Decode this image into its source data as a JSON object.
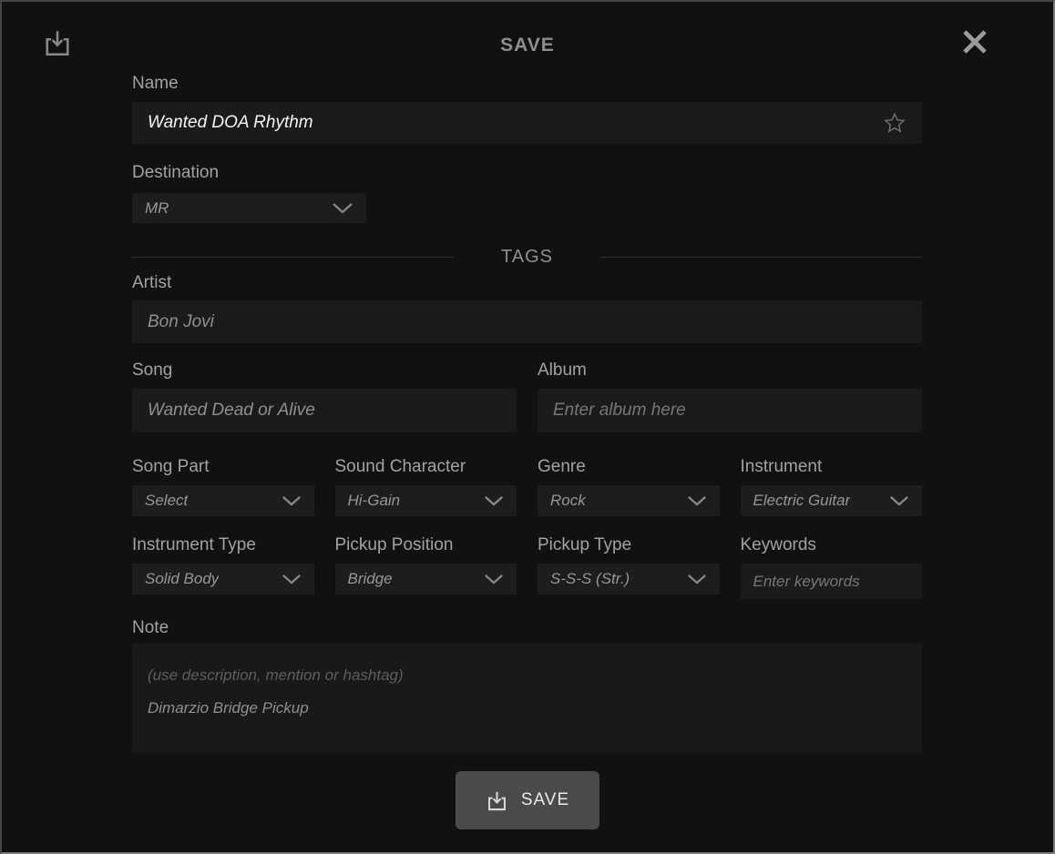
{
  "header": {
    "title": "SAVE"
  },
  "form": {
    "name": {
      "label": "Name",
      "value": "Wanted DOA Rhythm"
    },
    "destination": {
      "label": "Destination",
      "value": "MR"
    },
    "tags_divider": "TAGS",
    "artist": {
      "label": "Artist",
      "value": "Bon Jovi"
    },
    "song": {
      "label": "Song",
      "value": "Wanted Dead or Alive"
    },
    "album": {
      "label": "Album",
      "placeholder": "Enter album here"
    },
    "song_part": {
      "label": "Song Part",
      "value": "Select"
    },
    "sound_character": {
      "label": "Sound Character",
      "value": "Hi-Gain"
    },
    "genre": {
      "label": "Genre",
      "value": "Rock"
    },
    "instrument": {
      "label": "Instrument",
      "value": "Electric Guitar"
    },
    "instrument_type": {
      "label": "Instrument Type",
      "value": "Solid Body"
    },
    "pickup_position": {
      "label": "Pickup Position",
      "value": "Bridge"
    },
    "pickup_type": {
      "label": "Pickup Type",
      "value": "S-S-S (Str.)"
    },
    "keywords": {
      "label": "Keywords",
      "placeholder": "Enter keywords"
    },
    "note": {
      "label": "Note",
      "placeholder": "(use description, mention or hashtag)",
      "value": "Dimarzio Bridge Pickup"
    }
  },
  "footer": {
    "save_label": "SAVE"
  },
  "icons": {
    "download": "tray-with-down-arrow",
    "close": "x-cross",
    "star": "outline-star",
    "chevron": "chevron-down"
  },
  "colors": {
    "page_bg": "#111113",
    "field_bg": "#1b1b1d",
    "dropdown_bg": "#1d1d1f",
    "label_text": "#a2a2a4",
    "value_text": "#97979a",
    "name_value_text": "#f4f4f4",
    "button_bg": "#4a4a4c",
    "frame_border": "#7a7a7c"
  }
}
